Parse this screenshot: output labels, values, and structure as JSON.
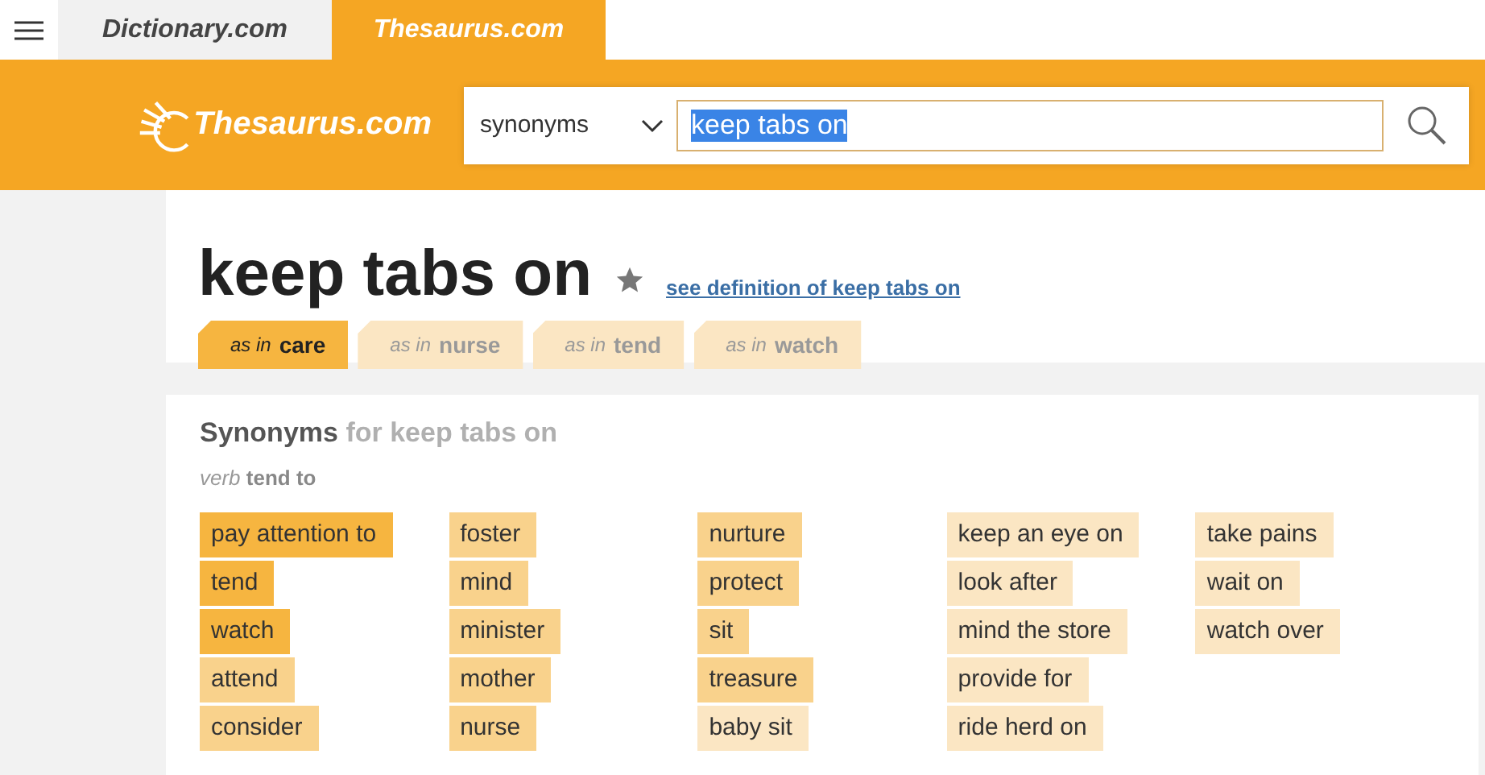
{
  "site_tabs": [
    {
      "label": "Dictionary.com",
      "selected": false
    },
    {
      "label": "Thesaurus.com",
      "selected": true
    }
  ],
  "header": {
    "logo": "Thesaurus.com",
    "search_type": "synonyms",
    "search_value": "keep tabs on"
  },
  "heading": {
    "word": "keep tabs on",
    "definition_link": "see definition of keep tabs on"
  },
  "sense_tabs": [
    {
      "prefix": "as in",
      "label": "care",
      "selected": true
    },
    {
      "prefix": "as in",
      "label": "nurse",
      "selected": false
    },
    {
      "prefix": "as in",
      "label": "tend",
      "selected": false
    },
    {
      "prefix": "as in",
      "label": "watch",
      "selected": false
    }
  ],
  "synonyms": {
    "title": "Synonyms",
    "subtitle": "for keep tabs on",
    "part_of_speech": "verb",
    "sense": "tend to",
    "columns": [
      [
        {
          "text": "pay attention to",
          "color": "#f6b540"
        },
        {
          "text": "tend",
          "color": "#f6b540"
        },
        {
          "text": "watch",
          "color": "#f6b540"
        },
        {
          "text": "attend",
          "color": "#f9d28c"
        },
        {
          "text": "consider",
          "color": "#f9d28c"
        }
      ],
      [
        {
          "text": "foster",
          "color": "#f9d28c"
        },
        {
          "text": "mind",
          "color": "#f9d28c"
        },
        {
          "text": "minister",
          "color": "#f9d28c"
        },
        {
          "text": "mother",
          "color": "#f9d28c"
        },
        {
          "text": "nurse",
          "color": "#f9d28c"
        }
      ],
      [
        {
          "text": "nurture",
          "color": "#f9d28c"
        },
        {
          "text": "protect",
          "color": "#f9d28c"
        },
        {
          "text": "sit",
          "color": "#f9d28c"
        },
        {
          "text": "treasure",
          "color": "#f9d28c"
        },
        {
          "text": "baby sit",
          "color": "#fbe6c3"
        }
      ],
      [
        {
          "text": "keep an eye on",
          "color": "#fbe6c3"
        },
        {
          "text": "look after",
          "color": "#fbe6c3"
        },
        {
          "text": "mind the store",
          "color": "#fbe6c3"
        },
        {
          "text": "provide for",
          "color": "#fbe6c3"
        },
        {
          "text": "ride herd on",
          "color": "#fbe6c3"
        }
      ],
      [
        {
          "text": "take pains",
          "color": "#fbe6c3"
        },
        {
          "text": "wait on",
          "color": "#fbe6c3"
        },
        {
          "text": "watch over",
          "color": "#fbe6c3"
        }
      ]
    ]
  }
}
